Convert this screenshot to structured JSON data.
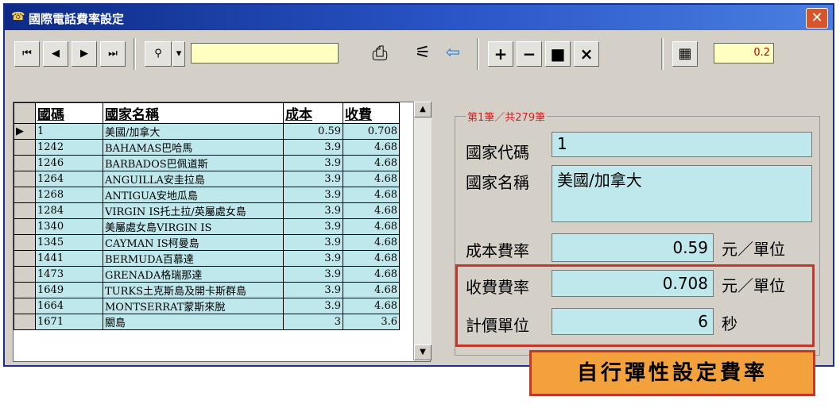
{
  "window": {
    "title": "國際電話費率設定",
    "close": "✕",
    "icon": "phone-icon"
  },
  "toolbar": {
    "first": "⏮",
    "prev": "◀",
    "next": "▶",
    "last": "⏭",
    "find": "⚲",
    "find_drop": "▾",
    "search_value": "",
    "print": "⎙",
    "connect": "⚟",
    "exit": "⇦",
    "add": "+",
    "remove": "−",
    "save": "■",
    "cancel": "×",
    "calc": "▦",
    "zoom_value": "0.2"
  },
  "grid": {
    "headers": [
      "國碼",
      "國家名稱",
      "成本",
      "收費"
    ],
    "rows": [
      {
        "code": "1",
        "name": "美國/加拿大",
        "cost": "0.59",
        "fee": "0.708",
        "current": true
      },
      {
        "code": "1242",
        "name": "BAHAMAS巴哈馬",
        "cost": "3.9",
        "fee": "4.68"
      },
      {
        "code": "1246",
        "name": "BARBADOS巴佩道斯",
        "cost": "3.9",
        "fee": "4.68"
      },
      {
        "code": "1264",
        "name": "ANGUILLA安圭拉島",
        "cost": "3.9",
        "fee": "4.68"
      },
      {
        "code": "1268",
        "name": "ANTIGUA安地瓜島",
        "cost": "3.9",
        "fee": "4.68"
      },
      {
        "code": "1284",
        "name": "VIRGIN IS托土拉/英屬處女島",
        "cost": "3.9",
        "fee": "4.68"
      },
      {
        "code": "1340",
        "name": "美屬處女島VIRGIN IS",
        "cost": "3.9",
        "fee": "4.68"
      },
      {
        "code": "1345",
        "name": "CAYMAN IS柯曼島",
        "cost": "3.9",
        "fee": "4.68"
      },
      {
        "code": "1441",
        "name": "BERMUDA百慕達",
        "cost": "3.9",
        "fee": "4.68"
      },
      {
        "code": "1473",
        "name": "GRENADA格瑞那達",
        "cost": "3.9",
        "fee": "4.68"
      },
      {
        "code": "1649",
        "name": "TURKS土克斯島及開卡斯群島",
        "cost": "3.9",
        "fee": "4.68"
      },
      {
        "code": "1664",
        "name": "MONTSERRAT蒙斯來脫",
        "cost": "3.9",
        "fee": "4.68"
      },
      {
        "code": "1671",
        "name": "關島",
        "cost": "3",
        "fee": "3.6"
      }
    ]
  },
  "detail": {
    "legend": "第1筆／共279筆",
    "country_code_label": "國家代碼",
    "country_code_value": "1",
    "country_name_label": "國家名稱",
    "country_name_value": "美國/加拿大",
    "cost_rate_label": "成本費率",
    "cost_rate_value": "0.59",
    "cost_rate_unit": "元／單位",
    "fee_rate_label": "收費費率",
    "fee_rate_value": "0.708",
    "fee_rate_unit": "元／單位",
    "billing_unit_label": "計價單位",
    "billing_unit_value": "6",
    "billing_unit_unit": "秒"
  },
  "banner": {
    "text": "自行彈性設定費率",
    "color": "#f2a13c",
    "border": "#c0392b"
  }
}
